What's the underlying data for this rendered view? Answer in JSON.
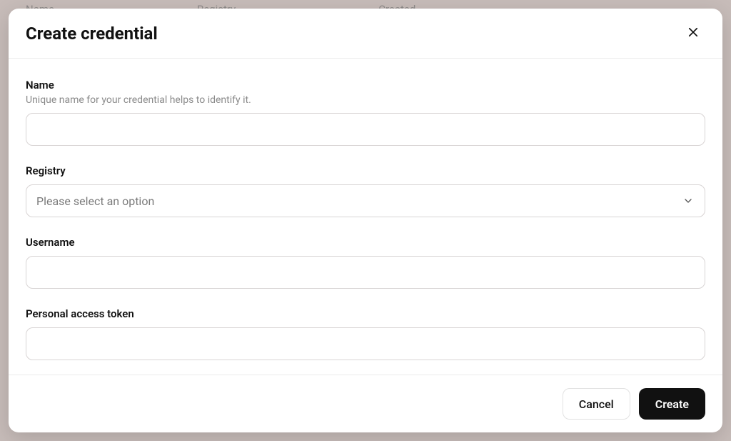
{
  "background": {
    "column_headers": [
      "Name",
      "Registry",
      "Created"
    ]
  },
  "modal": {
    "title": "Create credential",
    "fields": {
      "name": {
        "label": "Name",
        "hint": "Unique name for your credential helps to identify it.",
        "value": ""
      },
      "registry": {
        "label": "Registry",
        "placeholder": "Please select an option",
        "value": ""
      },
      "username": {
        "label": "Username",
        "value": ""
      },
      "token": {
        "label": "Personal access token",
        "value": ""
      }
    },
    "actions": {
      "cancel": "Cancel",
      "create": "Create"
    }
  }
}
